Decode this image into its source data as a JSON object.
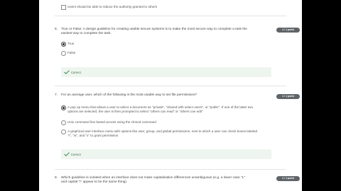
{
  "q5": {
    "option_partial": "Users should be able to reduce the authority granted to others"
  },
  "q6": {
    "number": "6.",
    "text": "True or False: A design guideline for creating usable secure systems is to make the most secure way to complete a task the easiest way to complete the task.",
    "points": "1 / 1 point",
    "options": [
      "True",
      "False"
    ],
    "selected_index": 0,
    "feedback": "Correct"
  },
  "q7": {
    "number": "7.",
    "text": "For an average user, which of the following is the most usable way to set file permissions?",
    "points": "1 / 1 point",
    "options": [
      "A pop up menu that allows a user to select a document as \"private\", \"shared with select users\", or \"public\". If one of the latter two options are selected, the user is then prompted to select \"others can read\" or \"others can edit\"",
      "Unix command line based access using the chmod command",
      "A graphical user interface menu with options like user, group, and global permissions, next to which a user can check boxes labeled \"r\", \"w\", and \"x\" to grant permission"
    ],
    "selected_index": 0,
    "feedback": "Correct"
  },
  "q8": {
    "number": "8.",
    "text": "Which guideline is violated when an interface does not make capitalization differences unambiguous (e.g. a lower case \"L\" and capital \"I\" appear to be the same thing)",
    "points": "1 / 1 point"
  },
  "colors": {
    "background": "#000000",
    "page": "#ffffff",
    "points_badge": "#5f6468",
    "feedback_bg": "#eef5ef",
    "check_green": "#2e8540"
  }
}
